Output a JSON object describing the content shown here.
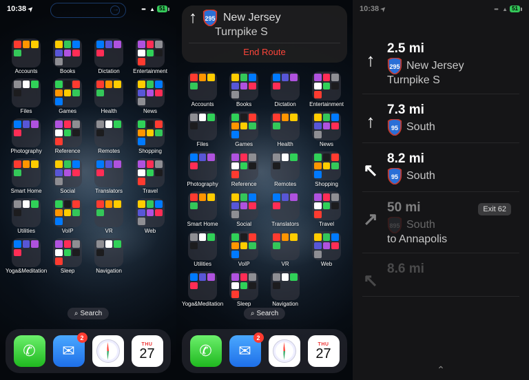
{
  "status": {
    "time": "10:38",
    "battery": "51"
  },
  "folders": [
    "Accounts",
    "Books",
    "Dictation",
    "Entertainment",
    "Files",
    "Games",
    "Health",
    "News",
    "Photography",
    "Reference",
    "Remotes",
    "Shopping",
    "Smart Home",
    "Social",
    "Translators",
    "Travel",
    "Utilities",
    "VoIP",
    "VR",
    "Web",
    "Yoga&Meditation",
    "Sleep",
    "Navigation"
  ],
  "search_label": "Search",
  "dock": {
    "mail_badge": "2",
    "cal_day": "THU",
    "cal_num": "27"
  },
  "banner": {
    "shield": "295",
    "line1": "New Jersey",
    "line2": "Turnpike S",
    "end": "End Route"
  },
  "directions": [
    {
      "dist": "2.5 mi",
      "shield": "295",
      "shield_color": "#2a6fd6",
      "text": "New Jersey",
      "text2": "Turnpike S",
      "arrow": "↑",
      "fade": ""
    },
    {
      "dist": "7.3 mi",
      "shield": "95",
      "shield_color": "#2a6fd6",
      "text": "South",
      "arrow": "↑",
      "fade": ""
    },
    {
      "dist": "8.2 mi",
      "shield": "95",
      "shield_color": "#2a6fd6",
      "text": "South",
      "arrow": "↖",
      "fade": ""
    },
    {
      "dist": "50 mi",
      "shield": "895",
      "shield_color": "#5a6170",
      "text": "South",
      "text2": "to Annapolis",
      "arrow": "↗",
      "exit": "Exit 62",
      "fade": "faded"
    },
    {
      "dist": "8.6 mi",
      "shield": "",
      "text": "",
      "arrow": "↖",
      "fade": "faded2"
    }
  ]
}
